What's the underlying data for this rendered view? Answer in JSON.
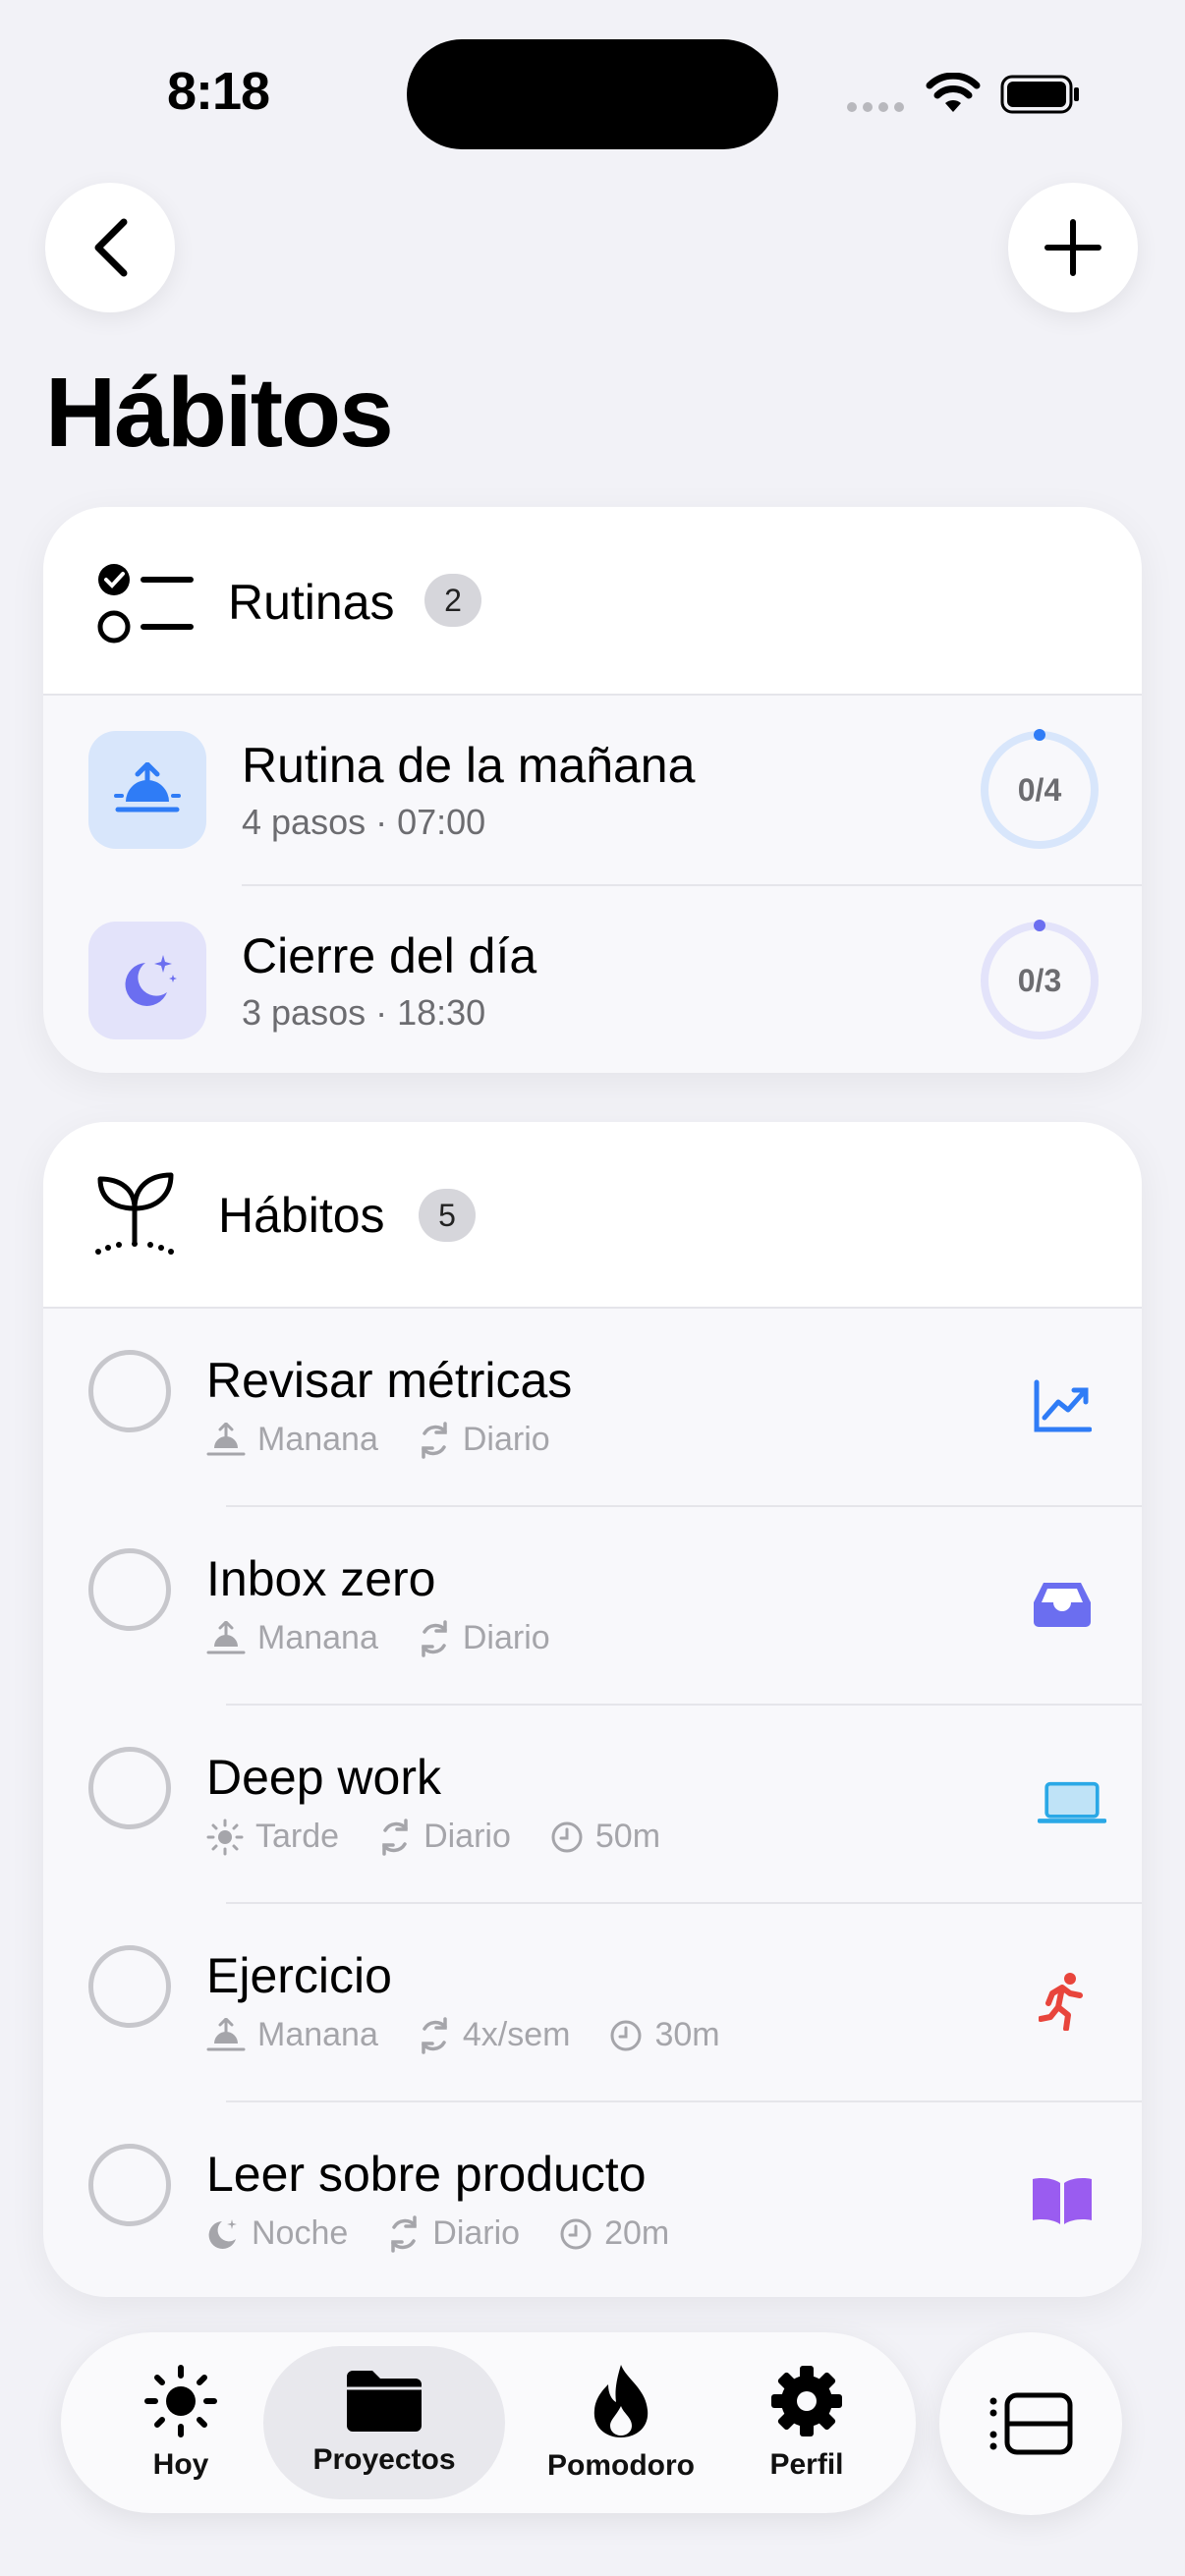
{
  "status_bar": {
    "time": "8:18"
  },
  "header": {
    "title": "Hábitos"
  },
  "routines": {
    "title": "Rutinas",
    "count": "2",
    "items": [
      {
        "name": "Rutina de la mañana",
        "subtitle": "4 pasos · 07:00",
        "progress": "0/4",
        "icon": "sunrise-icon",
        "color": "#2f7cf6"
      },
      {
        "name": "Cierre del día",
        "subtitle": "3 pasos · 18:30",
        "progress": "0/3",
        "icon": "moon-stars-icon",
        "color": "#6b6ef0"
      }
    ]
  },
  "habits": {
    "title": "Hábitos",
    "count": "5",
    "items": [
      {
        "name": "Revisar métricas",
        "time_of_day": "Manana",
        "frequency": "Diario",
        "duration": "",
        "icon": "chart-icon",
        "color": "#2f7cf6"
      },
      {
        "name": "Inbox zero",
        "time_of_day": "Manana",
        "frequency": "Diario",
        "duration": "",
        "icon": "tray-icon",
        "color": "#6b6ef0"
      },
      {
        "name": "Deep work",
        "time_of_day": "Tarde",
        "frequency": "Diario",
        "duration": "50m",
        "icon": "laptop-icon",
        "color": "#2aa8e6"
      },
      {
        "name": "Ejercicio",
        "time_of_day": "Manana",
        "frequency": "4x/sem",
        "duration": "30m",
        "icon": "running-icon",
        "color": "#e8453c"
      },
      {
        "name": "Leer sobre producto",
        "time_of_day": "Noche",
        "frequency": "Diario",
        "duration": "20m",
        "icon": "book-icon",
        "color": "#9a5cf0"
      }
    ]
  },
  "tabbar": {
    "tabs": [
      {
        "label": "Hoy",
        "icon": "sun-icon"
      },
      {
        "label": "Proyectos",
        "icon": "folder-icon",
        "active": true
      },
      {
        "label": "Pomodoro",
        "icon": "flame-icon"
      },
      {
        "label": "Perfil",
        "icon": "gear-icon"
      }
    ]
  }
}
